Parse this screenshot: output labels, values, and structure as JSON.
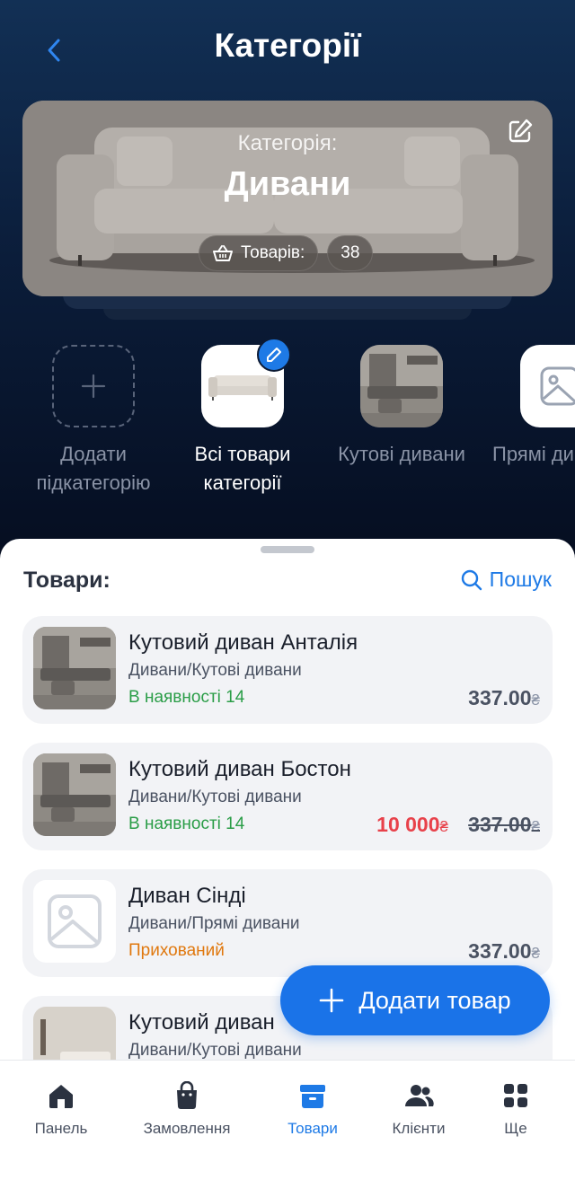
{
  "header": {
    "title": "Категорії"
  },
  "hero": {
    "category_label": "Категорія:",
    "category_name": "Дивани",
    "count_label": "Товарів:",
    "count_value": "38"
  },
  "subcategories": [
    {
      "label": "Додати підкатегорію"
    },
    {
      "label": "Всі товари категорії"
    },
    {
      "label": "Кутові дивани"
    },
    {
      "label": "Прямі ди"
    }
  ],
  "products_section": {
    "title": "Товари:",
    "search_label": "Пошук"
  },
  "products": [
    {
      "name": "Кутовий диван Анталія",
      "path": "Дивани/Кутові дивани",
      "status": "В наявності",
      "qty": "14",
      "price": "337.00",
      "currency": "₴"
    },
    {
      "name": "Кутовий диван Бостон",
      "path": "Дивани/Кутові дивани",
      "status": "В наявності",
      "qty": "14",
      "sale_price": "10 000",
      "price": "337.00",
      "currency": "₴"
    },
    {
      "name": "Диван Сінді",
      "path": "Дивани/Прямі дивани",
      "status": "Прихований",
      "price": "337.00",
      "currency": "₴"
    },
    {
      "name": "Кутовий диван",
      "path": "Дивани/Кутові дивани"
    }
  ],
  "fab": {
    "label": "Додати товар"
  },
  "tabbar": [
    {
      "label": "Панель",
      "icon": "home-icon"
    },
    {
      "label": "Замовлення",
      "icon": "bag-icon"
    },
    {
      "label": "Товари",
      "icon": "box-icon"
    },
    {
      "label": "Клієнти",
      "icon": "users-icon"
    },
    {
      "label": "Ще",
      "icon": "grid-icon"
    }
  ],
  "colors": {
    "accent": "#1e7ae6",
    "in_stock": "#2a9d47",
    "hidden": "#e0780e",
    "sale": "#e8414a"
  }
}
